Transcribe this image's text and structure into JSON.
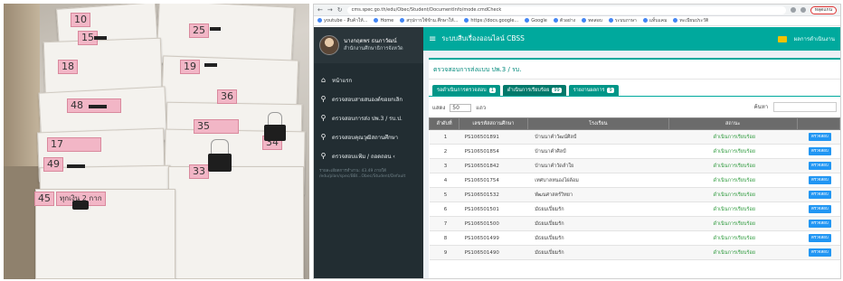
{
  "photo": {
    "labels": [
      "10",
      "15",
      "25",
      "19",
      "18",
      "36",
      "48",
      "35",
      "17",
      "34",
      "49",
      "33",
      "45"
    ],
    "label_45_note": "ทุกเงิน 2 กาก"
  },
  "browser": {
    "url": "cms.spec.go.th/edu/Obec/Student/DocumentInfo/mode.cmdCheck",
    "profile": "หลุดแกน",
    "bookmarks": [
      "youtube - สืบค้าให้...",
      "Home",
      "สรุปการใช้ข้าม.ศึกษาให้...",
      "https://docs.google...",
      "Google",
      "ตัวอย่าง",
      "ทดสอบ",
      "ระบบภาษา",
      "แท็บแคม",
      "ทะเบียนประวัติ"
    ]
  },
  "sidebar": {
    "user_name": "นางกฤตพร ธนภาวัฒน์",
    "user_org": "สำนักงานศึกษาธิการจังหวัด",
    "items": [
      {
        "icon": "home",
        "label": "หน้าแรก"
      },
      {
        "icon": "search",
        "label": "ตรวจสอบสายสนองต์ขอยกเลิก"
      },
      {
        "icon": "search",
        "label": "ตรวจสอบการส่ง ปพ.3 / รบ.ป."
      },
      {
        "icon": "search",
        "label": "ตรวจสอบคุณวุฒิสถานศึกษา"
      },
      {
        "icon": "search",
        "label": "ตรวจสอบแฟ้ม / ถอดถอน ‹"
      }
    ],
    "note": "รายละเอียดการทำงาน: 43.49 ภายใต้ /edu/plan/spec/BBI...Obec/Student/Default"
  },
  "app": {
    "title": "ระบบสืบเรื่องออนไลน์ CBSS",
    "top_link": "ผลการดำเนินงาน"
  },
  "panel": {
    "title": "ตรวจสอบการส่งแบบ ปพ.3 / รบ.",
    "tabs": [
      {
        "label": "รอดำเนินการตรวจสอบ",
        "count": "1"
      },
      {
        "label": "ดำเนินการเรียบร้อย",
        "count": "99"
      },
      {
        "label": "รายงานผลการ",
        "count": "9"
      }
    ],
    "show_prefix": "แสดง",
    "show_value": "50",
    "show_suffix": "แถว",
    "search_label": "ค้นหา"
  },
  "table": {
    "headers": [
      "ลำดับที่",
      "เลขรหัสสถานศึกษา",
      "โรงเรียน",
      "สถานะ",
      ""
    ],
    "rows": [
      {
        "n": "1",
        "code": "PS106501891",
        "school": "บ้านนาคำวัฒน์ศิลป์",
        "status": "ดำเนินการเรียบร้อย",
        "action": "ตรวจสอบ"
      },
      {
        "n": "2",
        "code": "PS106501854",
        "school": "บ้านนาคำศิลป์",
        "status": "ดำเนินการเรียบร้อย",
        "action": "ตรวจสอบ"
      },
      {
        "n": "3",
        "code": "PS106501842",
        "school": "บ้านนาคำวัดลำใย",
        "status": "ดำเนินการเรียบร้อย",
        "action": "ตรวจสอบ"
      },
      {
        "n": "4",
        "code": "PS106501754",
        "school": "เทศบาลหนองไผ่ล้อม",
        "status": "ดำเนินการเรียบร้อย",
        "action": "ตรวจสอบ"
      },
      {
        "n": "5",
        "code": "PS106501532",
        "school": "พัฒนศาสตร์วิทยา",
        "status": "ดำเนินการเรียบร้อย",
        "action": "ตรวจสอบ"
      },
      {
        "n": "6",
        "code": "PS106501501",
        "school": "มัธยมเปี่ยมรัก",
        "status": "ดำเนินการเรียบร้อย",
        "action": "ตรวจสอบ"
      },
      {
        "n": "7",
        "code": "PS106501500",
        "school": "มัธยมเปี่ยมรัก",
        "status": "ดำเนินการเรียบร้อย",
        "action": "ตรวจสอบ"
      },
      {
        "n": "8",
        "code": "PS106501499",
        "school": "มัธยมเปี่ยมรัก",
        "status": "ดำเนินการเรียบร้อย",
        "action": "ตรวจสอบ"
      },
      {
        "n": "9",
        "code": "PS106501490",
        "school": "มัธยมเปี่ยมรัก",
        "status": "ดำเนินการเรียบร้อย",
        "action": "ตรวจสอบ"
      }
    ]
  },
  "colors": {
    "accent": "#00a99d",
    "sidebar": "#222d32",
    "status_ok": "#2e9a3d",
    "action": "#2196f3"
  }
}
